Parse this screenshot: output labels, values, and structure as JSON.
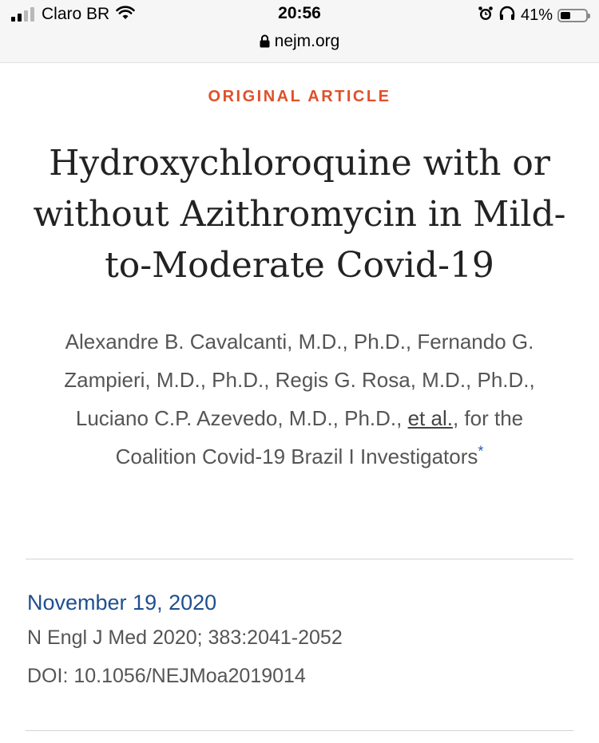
{
  "status_bar": {
    "carrier": "Claro BR",
    "time": "20:56",
    "battery_percent": "41%",
    "battery_level": 0.41,
    "url": "nejm.org",
    "icons": [
      "signal-bars-icon",
      "wifi-icon",
      "alarm-icon",
      "headphones-icon",
      "battery-icon",
      "lock-icon"
    ]
  },
  "article": {
    "kicker": "ORIGINAL ARTICLE",
    "title": "Hydroxychloroquine with or without Azithromycin in Mild-to-Moderate Covid-19",
    "authors_text": "Alexandre B. Cavalcanti, M.D., Ph.D., Fernando G. Zampieri, M.D., Ph.D., Regis G. Rosa, M.D., Ph.D., Luciano C.P. Azevedo, M.D., Ph.D., ",
    "et_al": "et al.",
    "authors_suffix": ", for the Coalition Covid-19 Brazil I Investigators",
    "asterisk": "*",
    "date": "November 19, 2020",
    "citation": "N Engl J Med 2020; 383:2041-2052",
    "doi": "DOI: 10.1056/NEJMoa2019014"
  },
  "colors": {
    "kicker": "#e0502a",
    "date_link": "#1f4f8f",
    "asterisk": "#2a5ca8"
  }
}
